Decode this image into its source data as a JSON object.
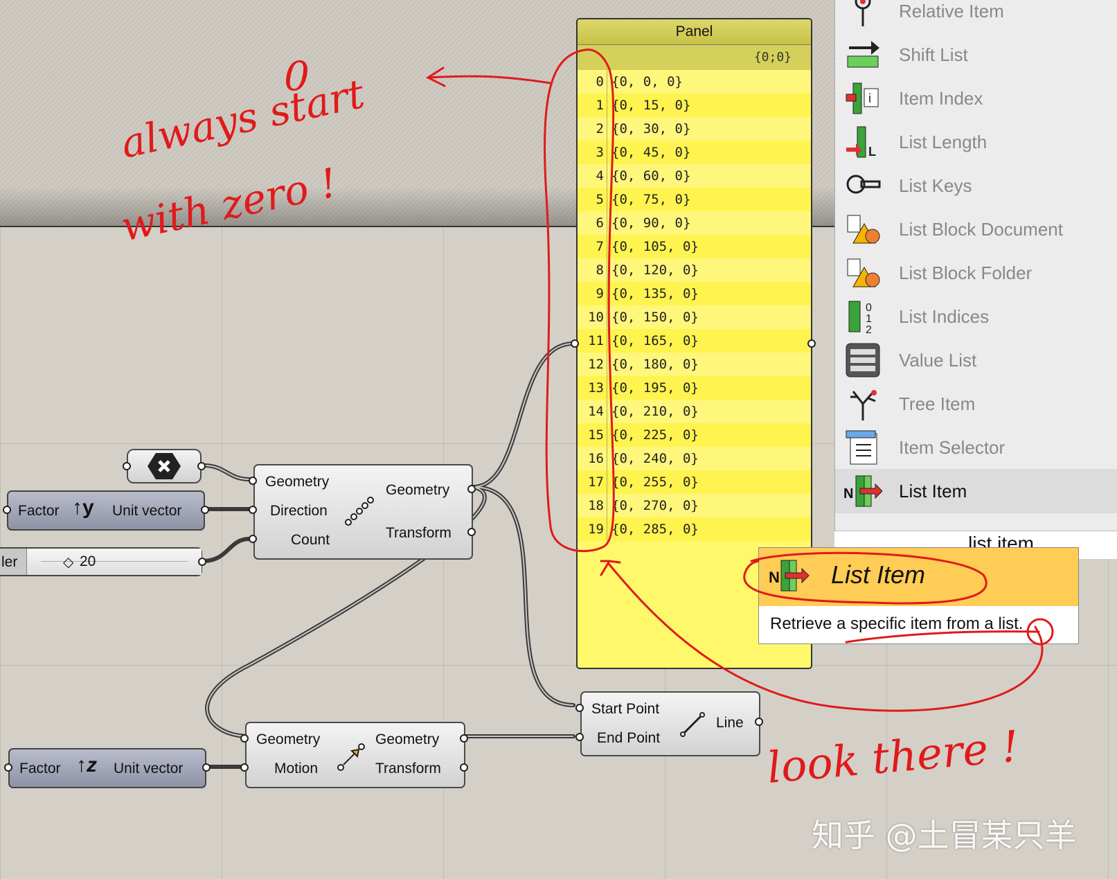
{
  "colors": {
    "annotation": "#e01a1a",
    "panel_fill": "#fff86a",
    "tooltip_header": "#ffcc55",
    "canvas": "#d4d0c8"
  },
  "annotations": {
    "zero_digit": "0",
    "line1": "always start",
    "line2": "with zero !",
    "look": "look there !"
  },
  "panel": {
    "title": "Panel",
    "path": "{0;0}",
    "rows": [
      {
        "i": "0",
        "v": "{0, 0, 0}"
      },
      {
        "i": "1",
        "v": "{0, 15, 0}"
      },
      {
        "i": "2",
        "v": "{0, 30, 0}"
      },
      {
        "i": "3",
        "v": "{0, 45, 0}"
      },
      {
        "i": "4",
        "v": "{0, 60, 0}"
      },
      {
        "i": "5",
        "v": "{0, 75, 0}"
      },
      {
        "i": "6",
        "v": "{0, 90, 0}"
      },
      {
        "i": "7",
        "v": "{0, 105, 0}"
      },
      {
        "i": "8",
        "v": "{0, 120, 0}"
      },
      {
        "i": "9",
        "v": "{0, 135, 0}"
      },
      {
        "i": "10",
        "v": "{0, 150, 0}"
      },
      {
        "i": "11",
        "v": "{0, 165, 0}"
      },
      {
        "i": "12",
        "v": "{0, 180, 0}"
      },
      {
        "i": "13",
        "v": "{0, 195, 0}"
      },
      {
        "i": "14",
        "v": "{0, 210, 0}"
      },
      {
        "i": "15",
        "v": "{0, 225, 0}"
      },
      {
        "i": "16",
        "v": "{0, 240, 0}"
      },
      {
        "i": "17",
        "v": "{0, 255, 0}"
      },
      {
        "i": "18",
        "v": "{0, 270, 0}"
      },
      {
        "i": "19",
        "v": "{0, 285, 0}"
      }
    ]
  },
  "linear_array": {
    "in": [
      "Geometry",
      "Direction",
      "Count"
    ],
    "out": [
      "Geometry",
      "Transform"
    ],
    "icon": "linear-array-icon"
  },
  "move": {
    "in": [
      "Geometry",
      "Motion"
    ],
    "out": [
      "Geometry",
      "Transform"
    ],
    "icon": "move-arrow-icon"
  },
  "line": {
    "in": [
      "Start Point",
      "End Point"
    ],
    "out": "Line",
    "icon": "line-icon"
  },
  "unit_y": {
    "in": "Factor",
    "glyph": "y",
    "out": "Unit vector"
  },
  "unit_z": {
    "in": "Factor",
    "glyph": "z",
    "out": "Unit vector"
  },
  "number_slider": {
    "label": "ler",
    "value": "20"
  },
  "menu": {
    "items": [
      {
        "label": "Relative Item",
        "icon": "relative-item-icon"
      },
      {
        "label": "Shift List",
        "icon": "shift-list-icon"
      },
      {
        "label": "Item Index",
        "icon": "item-index-icon"
      },
      {
        "label": "List Length",
        "icon": "list-length-icon"
      },
      {
        "label": "List Keys",
        "icon": "list-keys-icon"
      },
      {
        "label": "List Block Document",
        "icon": "list-block-document-icon"
      },
      {
        "label": "List Block Folder",
        "icon": "list-block-folder-icon"
      },
      {
        "label": "List Indices",
        "icon": "list-indices-icon"
      },
      {
        "label": "Value List",
        "icon": "value-list-icon"
      },
      {
        "label": "Tree Item",
        "icon": "tree-item-icon"
      },
      {
        "label": "Item Selector",
        "icon": "item-selector-icon"
      },
      {
        "label": "List Item",
        "icon": "list-item-icon",
        "selected": true
      }
    ],
    "search_text": "list item"
  },
  "tooltip": {
    "title": "List Item",
    "description": "Retrieve a specific item from a list."
  },
  "watermark": "知乎 @土冒某只羊"
}
